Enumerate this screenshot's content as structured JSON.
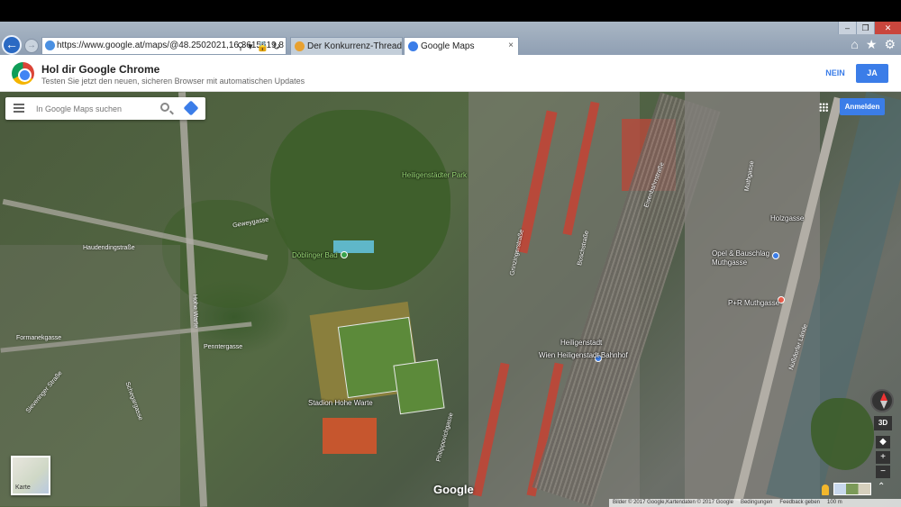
{
  "browser": {
    "address_url": "https://www.google.at/maps/@48.2502021,16.3615619,8",
    "tabs": [
      {
        "label": "Der Konkurrenz-Thread - Seite ..."
      },
      {
        "label": "Google Maps",
        "close": "×"
      }
    ],
    "window_controls": {
      "minimize": "–",
      "maximize": "❐",
      "close": "✕"
    }
  },
  "promo": {
    "title": "Hol dir Google Chrome",
    "subtitle": "Testen Sie jetzt den neuen, sicheren Browser mit automatischen Updates",
    "no_label": "NEIN",
    "yes_label": "JA"
  },
  "map": {
    "search_placeholder": "In Google Maps suchen",
    "signin_label": "Anmelden",
    "karte_label": "Karte",
    "google_logo": "Google",
    "ctrl_3d": "3D",
    "zoom_in": "+",
    "zoom_out": "−",
    "places": {
      "heiligenstadter_park": "Heiligenstädter Park",
      "doblinger_bad": "Döblinger Bad",
      "stadion": "Stadion Hohe Warte",
      "bahnhof_1": "Heiligenstadt",
      "bahnhof_2": "Wien Heiligenstadt Bahnhof",
      "bauschlag": "Opel & Bauschlag",
      "bauschlag_2": "Muthgasse",
      "park_ride": "P+R Muthgasse",
      "holzgasse": "Holzgasse"
    },
    "streets": {
      "gewey": "Geweygasse",
      "hauden": "Hauden­dingstraße",
      "formanek": "Formanekgasse",
      "pentner": "Penntergasse",
      "hohe_warte": "Hohe Warte",
      "grinzinger": "Grinzingerstraße",
      "boschstrasse": "Boschstraße",
      "muth": "Muthgasse",
      "nussdorfer": "Nußdorfer Lände",
      "eisenbahn": "Eisenbahnstraße",
      "philippov": "Philippovichgasse",
      "sieben": "Sieveringer Straße",
      "schegargasse": "Schegargasse"
    },
    "footer": {
      "data": "Bilder © 2017 Google,Kartendaten © 2017 Google",
      "terms": "Bedingungen",
      "feedback": "Feedback geben",
      "scale": "100 m"
    }
  }
}
